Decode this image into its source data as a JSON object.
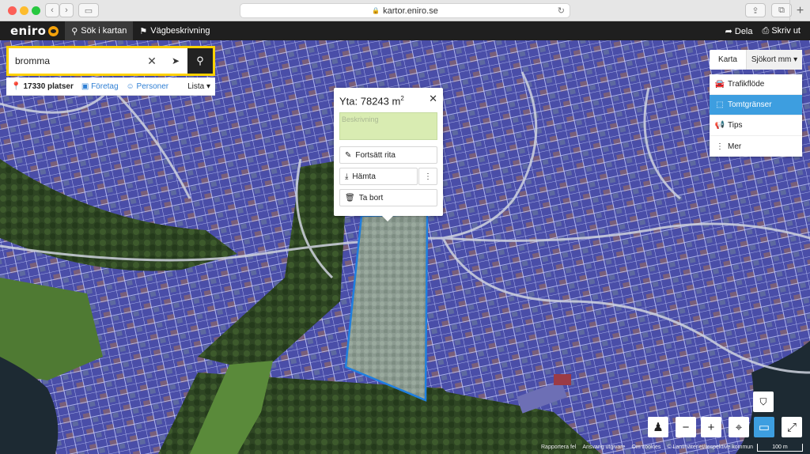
{
  "browser": {
    "url": "kartor.eniro.se",
    "colors": {
      "close": "#fc5f57",
      "minimize": "#fdbc2e",
      "zoom": "#28c840"
    }
  },
  "header": {
    "logo": "eniro",
    "tabs": [
      {
        "label": "Sök i kartan",
        "icon": "search-icon"
      },
      {
        "label": "Vägbeskrivning",
        "icon": "signpost-icon"
      }
    ],
    "actions": [
      {
        "label": "Dela",
        "icon": "share-icon"
      },
      {
        "label": "Skriv ut",
        "icon": "print-icon"
      }
    ]
  },
  "search": {
    "value": "bromma",
    "result_count": "17330 platser",
    "categories": [
      "Företag",
      "Personer"
    ],
    "list_label": "Lista"
  },
  "measure_popup": {
    "area_label": "Yta: 78243 m",
    "area_unit_sup": "2",
    "description_placeholder": "Beskrivning",
    "buttons": {
      "continue": "Fortsätt rita",
      "download": "Hämta",
      "delete": "Ta bort"
    }
  },
  "map_type": {
    "options": [
      "Karta",
      "Sjökort mm"
    ],
    "selected": "Sjökort mm"
  },
  "layers": [
    {
      "label": "Trafikflöde",
      "icon": "car-icon",
      "active": false
    },
    {
      "label": "Tomtgränser",
      "icon": "boundary-icon",
      "active": true
    },
    {
      "label": "Tips",
      "icon": "megaphone-icon",
      "active": false
    },
    {
      "label": "Mer",
      "icon": "more-icon",
      "active": false
    }
  ],
  "attribution": [
    "Rapportera fel",
    "Ansvarig utgivare",
    "Om cookies",
    "© Lantmäteriet/respektive kommun"
  ],
  "scale_label": "100 m",
  "colors": {
    "accent_yellow": "#ffd200",
    "accent_blue": "#3d9ee0",
    "parcel_fill": "#4b4fb4",
    "forest": "#2f4a22",
    "measured_area_border": "#1f7fe0"
  }
}
